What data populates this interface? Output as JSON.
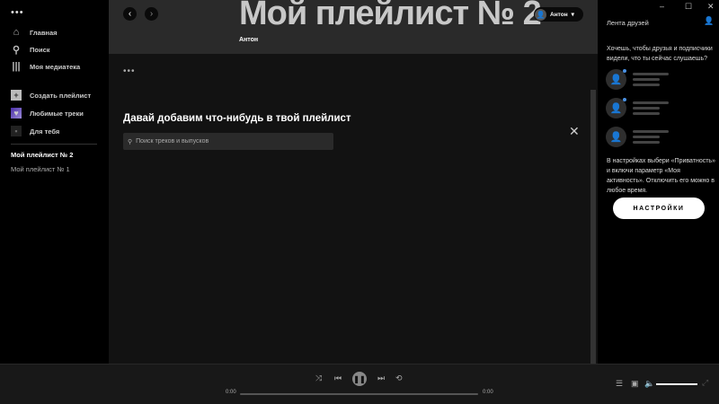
{
  "sidebar": {
    "menu_dots": "•••",
    "nav": [
      {
        "label": "Главная"
      },
      {
        "label": "Поиск"
      },
      {
        "label": "Моя медиатека"
      }
    ],
    "actions": [
      {
        "label": "Создать плейлист"
      },
      {
        "label": "Любимые треки"
      },
      {
        "label": "Для тебя"
      }
    ],
    "playlists": [
      "Мой плейлист № 2",
      "Мой плейлист № 1"
    ]
  },
  "header": {
    "title": "Мой плейлист № 2",
    "owner": "Антон",
    "user": "Антон"
  },
  "main": {
    "more": "•••",
    "add_heading": "Давай добавим что-нибудь в твой плейлист",
    "search_placeholder": "Поиск треков и выпусков"
  },
  "friends": {
    "title": "Лента друзей",
    "question": "Хочешь, чтобы друзья и подписчики видели, что ты сейчас слушаешь?",
    "instructions": "В настройках выбери «Приватность» и включи параметр «Моя активность». Отключить его можно в любое время.",
    "settings_button": "НАСТРОЙКИ"
  },
  "player": {
    "elapsed": "0:00",
    "duration": "0:00",
    "progress": 0,
    "volume": 1.0
  }
}
